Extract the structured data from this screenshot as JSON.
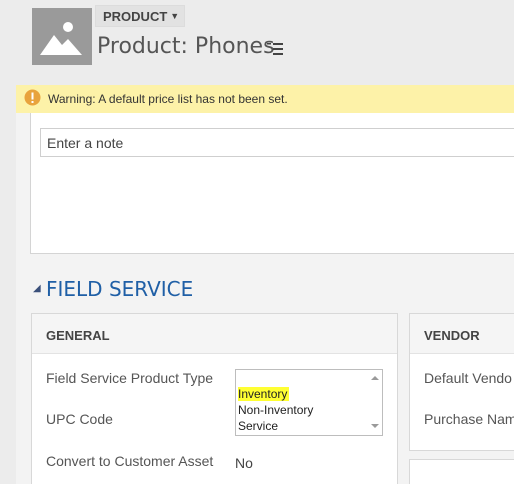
{
  "header": {
    "entity_type": "PRODUCT",
    "record_title": "Product: Phones"
  },
  "warning": {
    "text": "Warning: A default price list has not been set."
  },
  "notes": {
    "placeholder": "Enter a note"
  },
  "section": {
    "title": "FIELD SERVICE"
  },
  "general": {
    "title": "GENERAL",
    "labels": {
      "product_type": "Field Service Product Type",
      "upc_code": "UPC Code",
      "convert": "Convert to Customer Asset"
    },
    "convert_value": "No",
    "product_type_options": [
      "Inventory",
      "Non-Inventory",
      "Service"
    ],
    "product_type_selected": "Inventory"
  },
  "vendor": {
    "title": "VENDOR",
    "labels": {
      "default_vendor": "Default Vendo",
      "purchase_name": "Purchase Nam"
    }
  },
  "colors": {
    "warning_bg": "#fdf2a8",
    "warning_icon": "#e8a33d",
    "section_title": "#1f5fa6",
    "highlight": "#ffff33"
  },
  "icons": {
    "entity": "image-placeholder-icon",
    "warning": "exclamation-circle-icon",
    "title_menu": "list-menu-icon",
    "entity_dropdown": "caret-down-icon"
  }
}
